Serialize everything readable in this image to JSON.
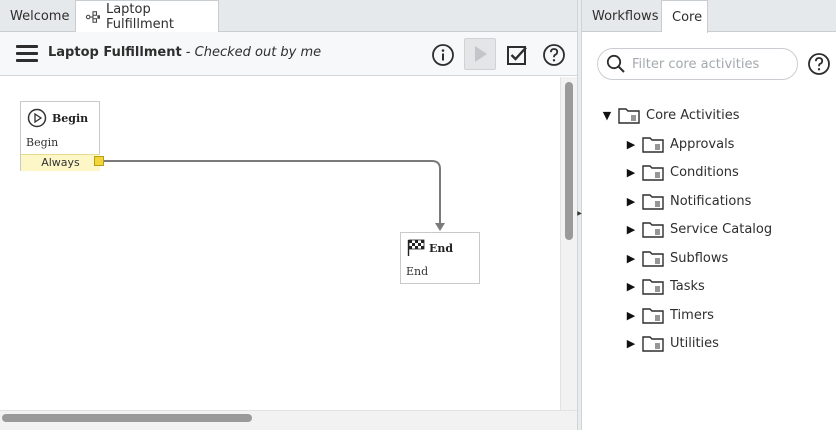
{
  "left_tabs": [
    {
      "label": "Welcome"
    },
    {
      "label": "Laptop Fulfillment"
    }
  ],
  "toolbar": {
    "title": "Laptop Fulfillment",
    "status": " - Checked out by me"
  },
  "canvas": {
    "begin": {
      "header": "Begin",
      "name": "Begin",
      "condition": "Always"
    },
    "end": {
      "header": "End",
      "name": "End"
    }
  },
  "right_tabs": [
    {
      "label": "Workflows"
    },
    {
      "label": "Core"
    }
  ],
  "search": {
    "placeholder": "Filter core activities",
    "value": ""
  },
  "tree": {
    "root": {
      "label": "Core Activities",
      "expanded": true
    },
    "children": [
      {
        "label": "Approvals"
      },
      {
        "label": "Conditions"
      },
      {
        "label": "Notifications"
      },
      {
        "label": "Service Catalog"
      },
      {
        "label": "Subflows"
      },
      {
        "label": "Tasks"
      },
      {
        "label": "Timers"
      },
      {
        "label": "Utilities"
      }
    ]
  },
  "icons": {
    "menu": "hamburger-icon",
    "info": "info-icon",
    "run": "play-icon",
    "checkin": "checkbox-icon",
    "help": "help-icon",
    "search": "search-icon",
    "folder": "folder-icon",
    "workflow": "workflow-icon",
    "begin": "play-circle-icon",
    "end": "checkered-flag-icon"
  },
  "colors": {
    "condition_bg": "#fdf7c8",
    "port": "#f3d43a",
    "tab_bar": "#e6e9eb"
  }
}
